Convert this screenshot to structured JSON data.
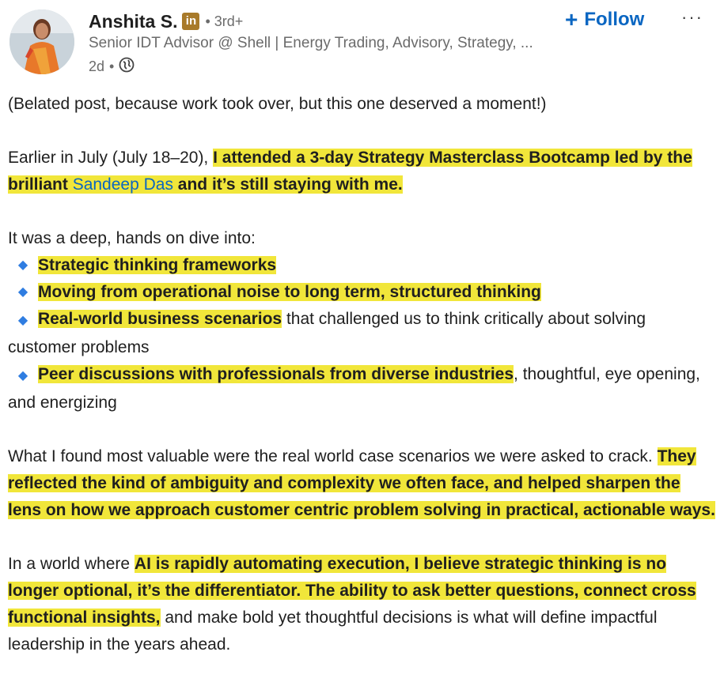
{
  "author": {
    "name": "Anshita S.",
    "badge": "in",
    "degree": "• 3rd+",
    "headline": "Senior IDT Advisor @ Shell | Energy Trading, Advisory, Strategy, ...",
    "time": "2d",
    "separator": "•",
    "visibility_icon": "globe-icon"
  },
  "actions": {
    "follow_plus": "+",
    "follow_label": "Follow",
    "more_label": "···"
  },
  "post": {
    "p1": "(Belated post, because work took over, but this one deserved a moment!)",
    "p2_a": "Earlier in July (July 18–20), ",
    "p2_hl1": "I attended a 3-day Strategy Masterclass Bootcamp led by the brilliant ",
    "p2_mention": "Sandeep Das",
    "p2_hl2": " and it’s still staying with me.",
    "p3": "It was a deep, hands on dive into:",
    "bullet_icon": "◆",
    "bullets": [
      {
        "hl": "Strategic thinking frameworks",
        "rest": ""
      },
      {
        "hl": "Moving from operational noise to long term, structured thinking",
        "rest": ""
      },
      {
        "hl": "Real-world business scenarios",
        "rest": " that challenged us to think critically about solving customer problems"
      },
      {
        "hl": "Peer discussions with professionals from diverse industries",
        "rest": ", thoughtful, eye opening, and energizing"
      }
    ],
    "p5_a": "What I found most valuable were the real world case scenarios we were asked to crack. ",
    "p5_hl": "They reflected the kind of ambiguity and complexity we often face, and helped sharpen the lens on how we approach customer centric problem solving in practical, actionable ways.",
    "p6_a": "In a world where ",
    "p6_hl": "AI is rapidly automating execution, I believe strategic thinking is no longer optional, it’s the differentiator. The ability to ask better questions, connect cross functional insights,",
    "p6_b": " and make bold yet thoughtful decisions is what will define impactful leadership in the years ahead."
  },
  "colors": {
    "highlight": "#f1e63a",
    "link": "#0a66c2",
    "bullet": "#2f7de1"
  }
}
